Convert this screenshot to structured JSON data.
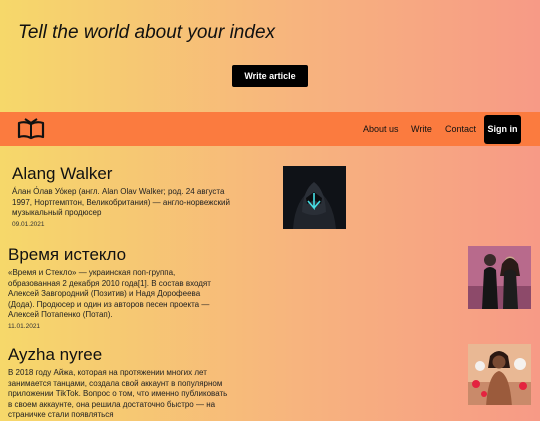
{
  "hero": {
    "title": "Tell the world about your index",
    "write_button": "Write article"
  },
  "nav": {
    "logo_icon": "open-book-icon",
    "links": [
      "About us",
      "Write",
      "Contact"
    ],
    "signin": "Sign in"
  },
  "articles": [
    {
      "title": "Alang Walker",
      "description": "Áлан О́лав Уо́кер (англ. Alan Olav Walker; род. 24 августа 1997, Нортгемптон, Великобритания) — англо-норвежский музыкальный продюсер",
      "date": "09.01.2021",
      "image": "masked-hooded-figure"
    },
    {
      "title": "Время истекло",
      "description": "«Время и Стекло» — украинская поп-группа, образованная 2 декабря 2010 года[1]. В состав входят Алексей Завгородний (Позитив) и Надя Дорофеева (Дода). Продюсер и один из авторов песен проекта — Алексей Потапенко (Потап).",
      "date": "11.01.2021",
      "image": "duo-band-photo"
    },
    {
      "title": "Ayzha nyree",
      "description": "В 2018 году Айжа, которая на протяжении многих лет занимается танцами, создала свой аккаунт в популярном приложении TikTok. Вопрос о том, что именно публиковать в своем аккаунте, она решила достаточно быстро — на страничке стали появляться",
      "date": "",
      "image": "woman-with-flowers"
    }
  ]
}
